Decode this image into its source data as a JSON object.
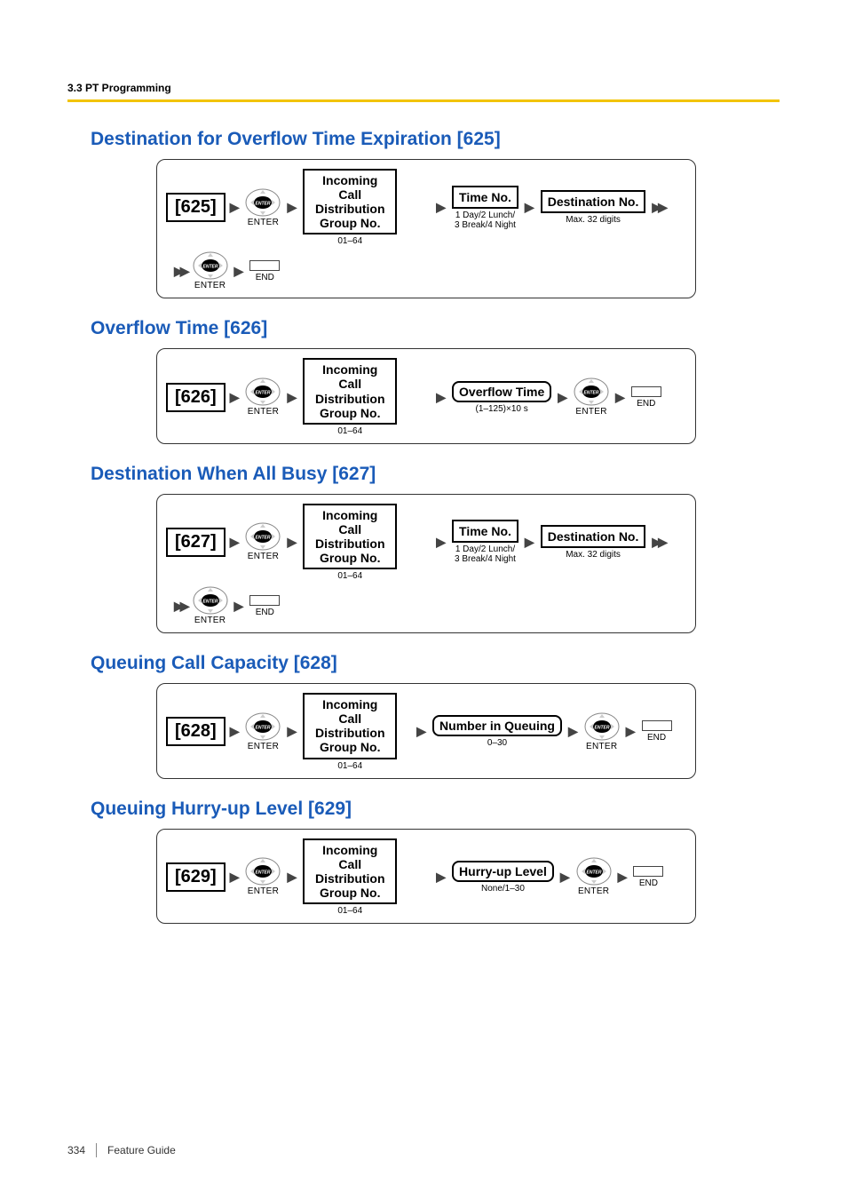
{
  "header": {
    "section": "3.3 PT Programming"
  },
  "footer": {
    "page": "334",
    "guide": "Feature Guide"
  },
  "labels": {
    "enter": "ENTER",
    "end": "END",
    "icd_group": "Incoming Call Distribution Group No.",
    "icd_range": "01–64",
    "time_no": "Time No.",
    "time_no_sub": "1 Day/2 Lunch/\n3 Break/4 Night",
    "dest_no": "Destination No.",
    "dest_no_sub": "Max. 32 digits"
  },
  "sections": [
    {
      "title": "Destination for Overflow Time Expiration [625]",
      "code": "[625]",
      "middle_label": "Time No.",
      "middle_sub": "1 Day/2 Lunch/\n3 Break/4 Night",
      "right_label": "Destination No.",
      "right_sub": "Max. 32 digits",
      "has_continuation": true,
      "rounded": false
    },
    {
      "title": "Overflow Time [626]",
      "code": "[626]",
      "middle_label": "Overflow Time",
      "middle_sub": "(1–125)×10 s",
      "has_continuation": false,
      "rounded": true,
      "has_end_inline": true
    },
    {
      "title": "Destination When All Busy [627]",
      "code": "[627]",
      "middle_label": "Time No.",
      "middle_sub": "1 Day/2 Lunch/\n3 Break/4 Night",
      "right_label": "Destination No.",
      "right_sub": "Max. 32 digits",
      "has_continuation": true,
      "rounded": false
    },
    {
      "title": "Queuing Call Capacity [628]",
      "code": "[628]",
      "middle_label": "Number in Queuing",
      "middle_sub": "0–30",
      "has_continuation": false,
      "rounded": true,
      "has_end_inline": true
    },
    {
      "title": "Queuing Hurry-up Level [629]",
      "code": "[629]",
      "middle_label": "Hurry-up Level",
      "middle_sub": "None/1–30",
      "has_continuation": false,
      "rounded": true,
      "has_end_inline": true
    }
  ]
}
